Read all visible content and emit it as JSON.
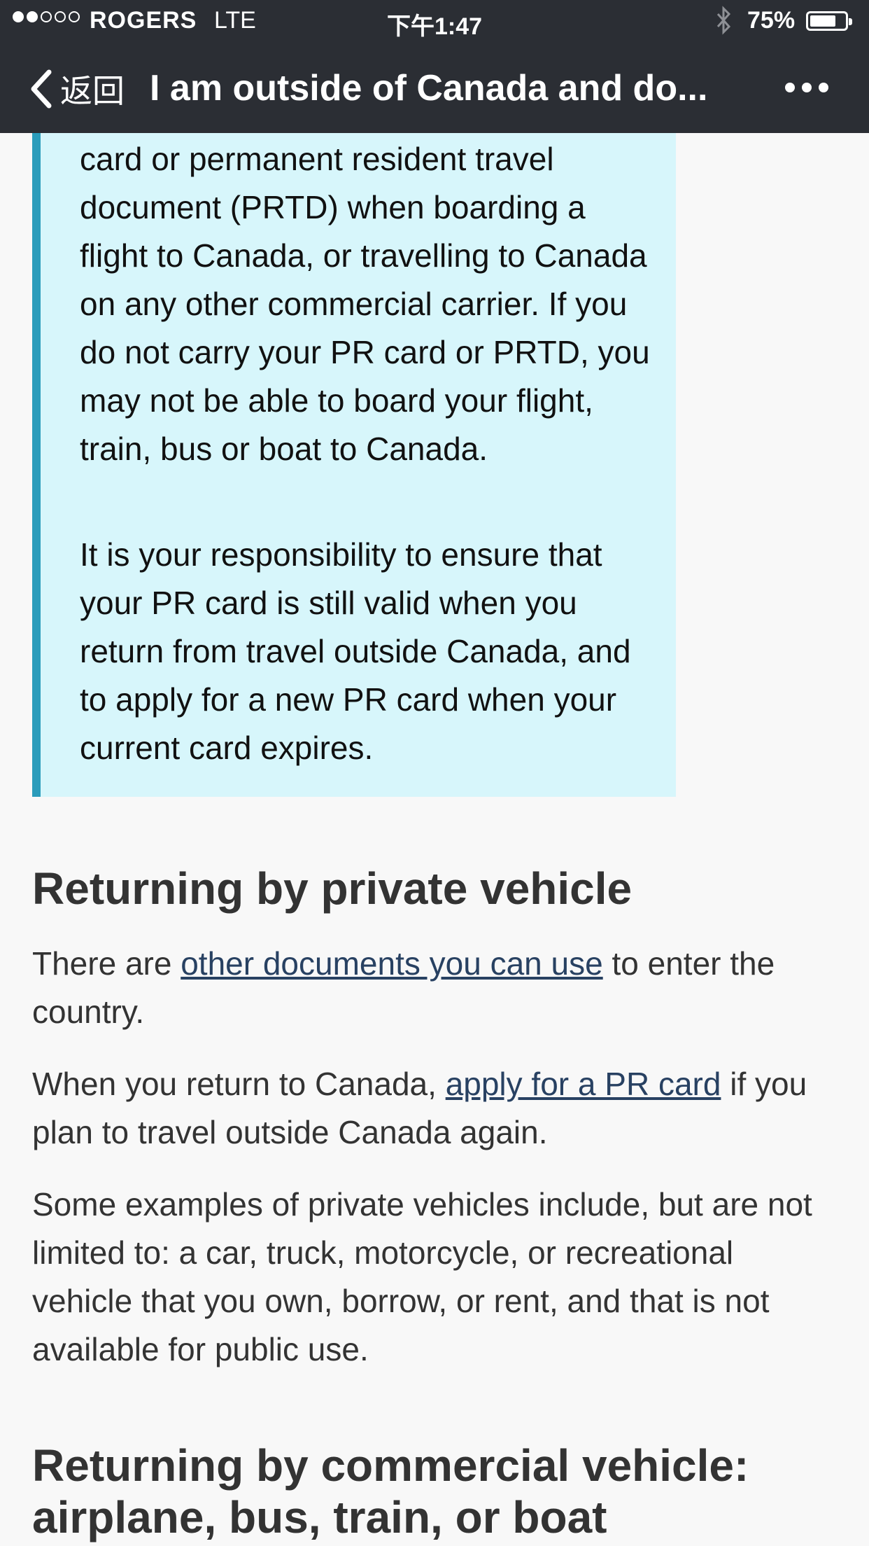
{
  "status_bar": {
    "carrier": "ROGERS",
    "network": "LTE",
    "time": "下午1:47",
    "battery_percent": "75%",
    "battery_level": 0.75,
    "signal_bars_filled": 2,
    "signal_bars_total": 5
  },
  "nav": {
    "back_label": "返回",
    "title": "I am outside of Canada and do..."
  },
  "callout": {
    "paragraph1": "card or permanent resident travel document (PRTD) when boarding a flight to Canada, or travelling to Canada on any other commercial carrier. If you do not carry your PR card or PRTD, you may not be able to board your flight, train, bus or boat to Canada.",
    "paragraph2": "It is your responsibility to ensure that your PR card is still valid when you return from travel outside Canada, and to apply for a new PR card when your current card expires."
  },
  "section_private": {
    "heading": "Returning by private vehicle",
    "p1_before": "There are ",
    "p1_link": "other documents you can use",
    "p1_after": " to enter the country.",
    "p2_before": "When you return to Canada, ",
    "p2_link": "apply for a PR card",
    "p2_after": " if you plan to travel outside Canada again.",
    "p3": "Some examples of private vehicles include, but are not limited to: a car, truck, motorcycle, or recreational vehicle that you own, borrow, or rent, and that is not available for public use."
  },
  "section_commercial": {
    "heading": "Returning by commercial vehicle: airplane, bus, train, or boat"
  },
  "colors": {
    "header_bg": "#2b2e34",
    "callout_bg": "#d7f6fb",
    "callout_border": "#2b9cbb",
    "link": "#284162"
  }
}
